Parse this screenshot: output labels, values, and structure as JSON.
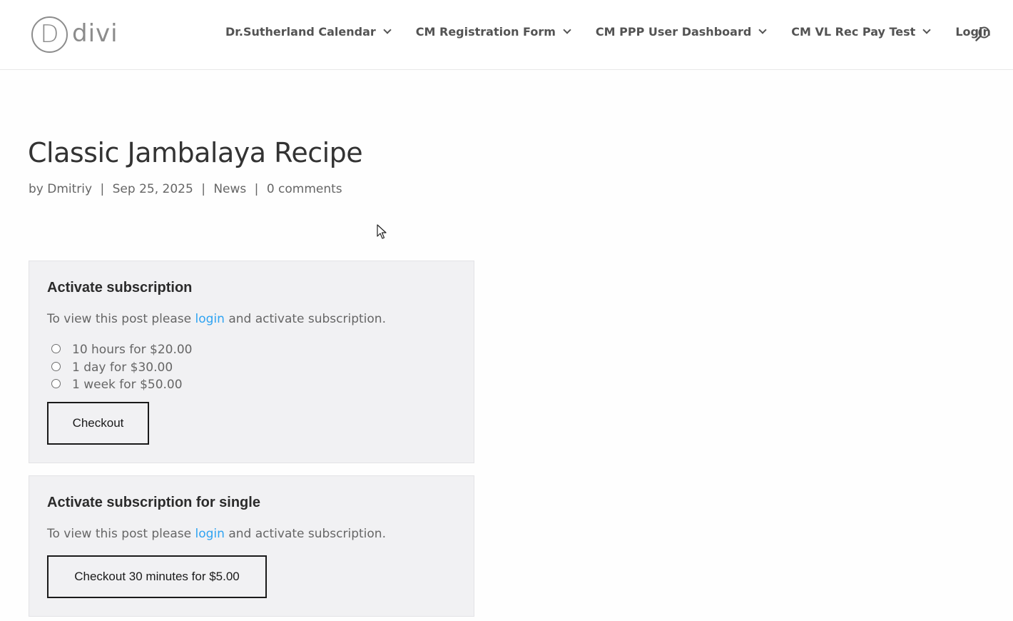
{
  "header": {
    "logo_letter": "D",
    "logo_text": "divi",
    "nav": [
      {
        "label": "Dr.Sutherland Calendar",
        "has_dropdown": true
      },
      {
        "label": "CM Registration Form",
        "has_dropdown": true
      },
      {
        "label": "CM PPP User Dashboard",
        "has_dropdown": true
      },
      {
        "label": "CM VL Rec Pay Test",
        "has_dropdown": true
      },
      {
        "label": "Login",
        "has_dropdown": false
      }
    ],
    "search_icon": "search-icon"
  },
  "post": {
    "title": "Classic Jambalaya Recipe",
    "meta": {
      "by": "by",
      "author": "Dmitriy",
      "separator": "|",
      "date": "Sep 25, 2025",
      "category": "News",
      "comments": "0 comments"
    }
  },
  "subscription_box": {
    "title": "Activate subscription",
    "text_before": "To view this post please ",
    "link": "login",
    "text_after": " and activate subscription.",
    "options": [
      {
        "label": "10 hours for $20.00",
        "selected": false
      },
      {
        "label": "1 day for $30.00",
        "selected": false
      },
      {
        "label": "1 week for $50.00",
        "selected": false
      }
    ],
    "button": "Checkout"
  },
  "single_box": {
    "title": "Activate subscription for single",
    "text_before": "To view this post please ",
    "link": "login",
    "text_after": " and activate subscription.",
    "button": "Checkout 30 minutes for $5.00"
  },
  "colors": {
    "link": "#2ea3f2",
    "title": "#333333",
    "text": "#666666",
    "box_bg": "#f1f1f3"
  }
}
